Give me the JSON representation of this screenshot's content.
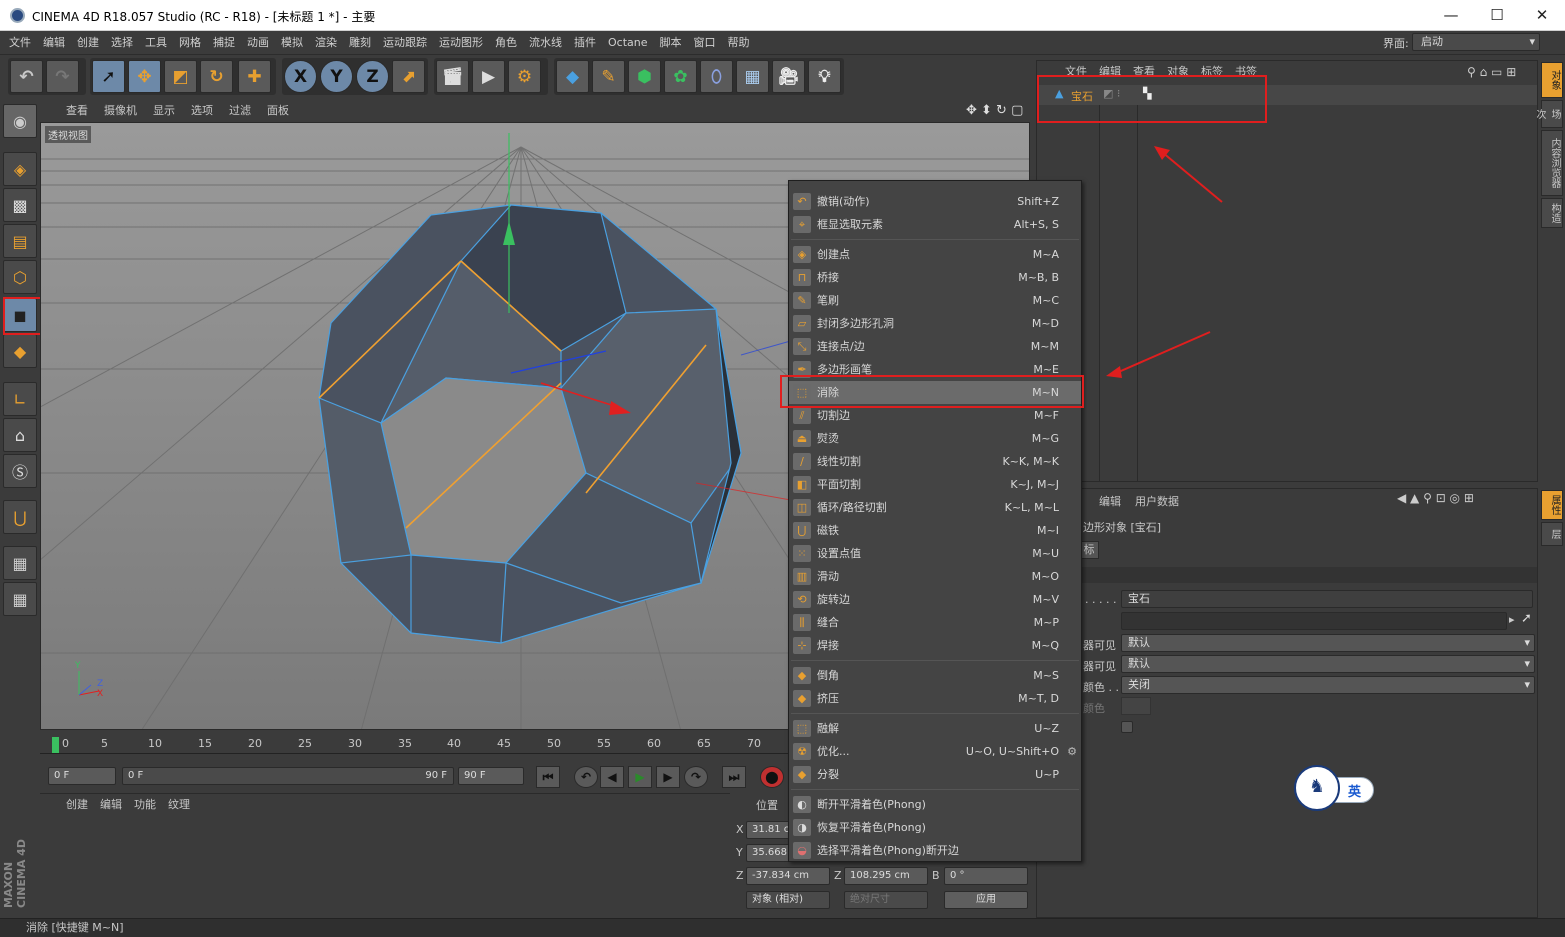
{
  "window": {
    "title": "CINEMA 4D R18.057 Studio (RC - R18) - [未标题 1 *] - 主要",
    "minimize": "—",
    "maximize": "☐",
    "close": "✕"
  },
  "menubar": {
    "items": [
      "文件",
      "编辑",
      "创建",
      "选择",
      "工具",
      "网格",
      "捕捉",
      "动画",
      "模拟",
      "渲染",
      "雕刻",
      "运动跟踪",
      "运动图形",
      "角色",
      "流水线",
      "插件",
      "Octane",
      "脚本",
      "窗口",
      "帮助"
    ],
    "layout_label": "界面:",
    "layout_value": "启动"
  },
  "toolbar": {
    "undo": "↶",
    "redo": "↷",
    "tools": [
      "select-live",
      "move",
      "scale",
      "rotate",
      "add"
    ],
    "axis": [
      "X",
      "Y",
      "Z"
    ]
  },
  "viewport": {
    "menu": [
      "查看",
      "摄像机",
      "显示",
      "选项",
      "过滤",
      "面板"
    ],
    "label": "透视视图",
    "axis_y": "Y",
    "axis_z": "Z",
    "axis_x": "X"
  },
  "timeline": {
    "ticks": [
      "0",
      "5",
      "10",
      "15",
      "20",
      "25",
      "30",
      "35",
      "40",
      "45",
      "50",
      "55",
      "60",
      "65",
      "70"
    ],
    "current_frame": "0 F",
    "range_start": "0 F",
    "range_end_inner": "90 F",
    "range_end": "90 F"
  },
  "material_panel": {
    "menu": [
      "创建",
      "编辑",
      "功能",
      "纹理"
    ]
  },
  "coord_panel": {
    "title": "位置",
    "x_label": "X",
    "x_value": "31.81 c",
    "y_label": "Y",
    "y_value": "35.668",
    "z_label": "Z",
    "z_value": "-37.834 cm",
    "z2_label": "Z",
    "z2_value": "108.295 cm",
    "b_label": "B",
    "b_value": "0 °",
    "mode": "对象 (相对)",
    "size_mode": "绝对尺寸",
    "apply": "应用"
  },
  "object_manager": {
    "menu": [
      "文件",
      "编辑",
      "查看",
      "对象",
      "标签",
      "书签"
    ],
    "object_name": "宝石"
  },
  "attribute_manager": {
    "menu": [
      "编辑",
      "用户数据"
    ],
    "object_title": "边形对象 [宝石]",
    "tab_basic": "标",
    "name_value": "宝石",
    "row1_label": "器可见",
    "row1_value": "默认",
    "row2_label": "器可见",
    "row2_value": "默认",
    "row3_label": "颜色 . . .",
    "row3_value": "关闭",
    "row4_label": "颜色",
    "dots": ". . . . ."
  },
  "right_tabs": [
    "对象",
    "场次",
    "内容浏览器",
    "构造",
    "属性",
    "层"
  ],
  "context_menu": {
    "items": [
      {
        "label": "撤销(动作)",
        "key": "Shift+Z"
      },
      {
        "label": "框显选取元素",
        "key": "Alt+S, S"
      },
      {
        "label": "创建点",
        "key": "M~A"
      },
      {
        "label": "桥接",
        "key": "M~B, B"
      },
      {
        "label": "笔刷",
        "key": "M~C"
      },
      {
        "label": "封闭多边形孔洞",
        "key": "M~D"
      },
      {
        "label": "连接点/边",
        "key": "M~M"
      },
      {
        "label": "多边形画笔",
        "key": "M~E"
      },
      {
        "label": "消除",
        "key": "M~N"
      },
      {
        "label": "切割边",
        "key": "M~F"
      },
      {
        "label": "熨烫",
        "key": "M~G"
      },
      {
        "label": "线性切割",
        "key": "K~K, M~K"
      },
      {
        "label": "平面切割",
        "key": "K~J, M~J"
      },
      {
        "label": "循环/路径切割",
        "key": "K~L, M~L"
      },
      {
        "label": "磁铁",
        "key": "M~I"
      },
      {
        "label": "设置点值",
        "key": "M~U"
      },
      {
        "label": "滑动",
        "key": "M~O"
      },
      {
        "label": "旋转边",
        "key": "M~V"
      },
      {
        "label": "缝合",
        "key": "M~P"
      },
      {
        "label": "焊接",
        "key": "M~Q"
      },
      {
        "label": "倒角",
        "key": "M~S"
      },
      {
        "label": "挤压",
        "key": "M~T, D"
      },
      {
        "label": "融解",
        "key": "U~Z"
      },
      {
        "label": "优化...",
        "key": "U~O, U~Shift+O"
      },
      {
        "label": "分裂",
        "key": "U~P"
      },
      {
        "label": "断开平滑着色(Phong)",
        "key": ""
      },
      {
        "label": "恢复平滑着色(Phong)",
        "key": ""
      },
      {
        "label": "选择平滑着色(Phong)断开边",
        "key": ""
      }
    ]
  },
  "status": "消除 [快捷键 M~N]",
  "brand": "MAXON CINEMA 4D",
  "ime": {
    "label": "英"
  },
  "colors": {
    "accent": "#e8a030",
    "highlight": "#e01e1e",
    "selection": "#6d89a8"
  }
}
